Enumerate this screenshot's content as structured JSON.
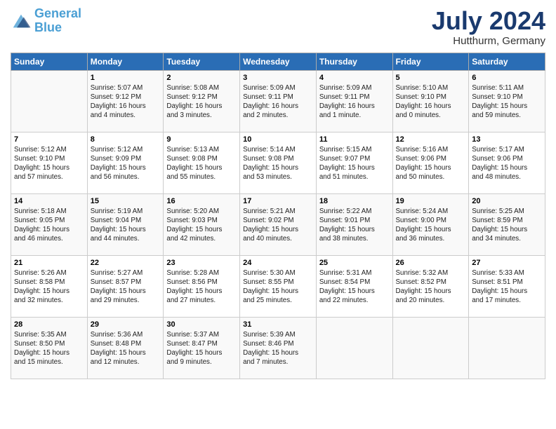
{
  "app": {
    "name": "GeneralBlue",
    "logo_line1": "General",
    "logo_line2": "Blue"
  },
  "calendar": {
    "month_year": "July 2024",
    "location": "Hutthurm, Germany",
    "weekdays": [
      "Sunday",
      "Monday",
      "Tuesday",
      "Wednesday",
      "Thursday",
      "Friday",
      "Saturday"
    ],
    "weeks": [
      [
        {
          "day": "",
          "info": ""
        },
        {
          "day": "1",
          "info": "Sunrise: 5:07 AM\nSunset: 9:12 PM\nDaylight: 16 hours\nand 4 minutes."
        },
        {
          "day": "2",
          "info": "Sunrise: 5:08 AM\nSunset: 9:12 PM\nDaylight: 16 hours\nand 3 minutes."
        },
        {
          "day": "3",
          "info": "Sunrise: 5:09 AM\nSunset: 9:11 PM\nDaylight: 16 hours\nand 2 minutes."
        },
        {
          "day": "4",
          "info": "Sunrise: 5:09 AM\nSunset: 9:11 PM\nDaylight: 16 hours\nand 1 minute."
        },
        {
          "day": "5",
          "info": "Sunrise: 5:10 AM\nSunset: 9:10 PM\nDaylight: 16 hours\nand 0 minutes."
        },
        {
          "day": "6",
          "info": "Sunrise: 5:11 AM\nSunset: 9:10 PM\nDaylight: 15 hours\nand 59 minutes."
        }
      ],
      [
        {
          "day": "7",
          "info": "Sunrise: 5:12 AM\nSunset: 9:10 PM\nDaylight: 15 hours\nand 57 minutes."
        },
        {
          "day": "8",
          "info": "Sunrise: 5:12 AM\nSunset: 9:09 PM\nDaylight: 15 hours\nand 56 minutes."
        },
        {
          "day": "9",
          "info": "Sunrise: 5:13 AM\nSunset: 9:08 PM\nDaylight: 15 hours\nand 55 minutes."
        },
        {
          "day": "10",
          "info": "Sunrise: 5:14 AM\nSunset: 9:08 PM\nDaylight: 15 hours\nand 53 minutes."
        },
        {
          "day": "11",
          "info": "Sunrise: 5:15 AM\nSunset: 9:07 PM\nDaylight: 15 hours\nand 51 minutes."
        },
        {
          "day": "12",
          "info": "Sunrise: 5:16 AM\nSunset: 9:06 PM\nDaylight: 15 hours\nand 50 minutes."
        },
        {
          "day": "13",
          "info": "Sunrise: 5:17 AM\nSunset: 9:06 PM\nDaylight: 15 hours\nand 48 minutes."
        }
      ],
      [
        {
          "day": "14",
          "info": "Sunrise: 5:18 AM\nSunset: 9:05 PM\nDaylight: 15 hours\nand 46 minutes."
        },
        {
          "day": "15",
          "info": "Sunrise: 5:19 AM\nSunset: 9:04 PM\nDaylight: 15 hours\nand 44 minutes."
        },
        {
          "day": "16",
          "info": "Sunrise: 5:20 AM\nSunset: 9:03 PM\nDaylight: 15 hours\nand 42 minutes."
        },
        {
          "day": "17",
          "info": "Sunrise: 5:21 AM\nSunset: 9:02 PM\nDaylight: 15 hours\nand 40 minutes."
        },
        {
          "day": "18",
          "info": "Sunrise: 5:22 AM\nSunset: 9:01 PM\nDaylight: 15 hours\nand 38 minutes."
        },
        {
          "day": "19",
          "info": "Sunrise: 5:24 AM\nSunset: 9:00 PM\nDaylight: 15 hours\nand 36 minutes."
        },
        {
          "day": "20",
          "info": "Sunrise: 5:25 AM\nSunset: 8:59 PM\nDaylight: 15 hours\nand 34 minutes."
        }
      ],
      [
        {
          "day": "21",
          "info": "Sunrise: 5:26 AM\nSunset: 8:58 PM\nDaylight: 15 hours\nand 32 minutes."
        },
        {
          "day": "22",
          "info": "Sunrise: 5:27 AM\nSunset: 8:57 PM\nDaylight: 15 hours\nand 29 minutes."
        },
        {
          "day": "23",
          "info": "Sunrise: 5:28 AM\nSunset: 8:56 PM\nDaylight: 15 hours\nand 27 minutes."
        },
        {
          "day": "24",
          "info": "Sunrise: 5:30 AM\nSunset: 8:55 PM\nDaylight: 15 hours\nand 25 minutes."
        },
        {
          "day": "25",
          "info": "Sunrise: 5:31 AM\nSunset: 8:54 PM\nDaylight: 15 hours\nand 22 minutes."
        },
        {
          "day": "26",
          "info": "Sunrise: 5:32 AM\nSunset: 8:52 PM\nDaylight: 15 hours\nand 20 minutes."
        },
        {
          "day": "27",
          "info": "Sunrise: 5:33 AM\nSunset: 8:51 PM\nDaylight: 15 hours\nand 17 minutes."
        }
      ],
      [
        {
          "day": "28",
          "info": "Sunrise: 5:35 AM\nSunset: 8:50 PM\nDaylight: 15 hours\nand 15 minutes."
        },
        {
          "day": "29",
          "info": "Sunrise: 5:36 AM\nSunset: 8:48 PM\nDaylight: 15 hours\nand 12 minutes."
        },
        {
          "day": "30",
          "info": "Sunrise: 5:37 AM\nSunset: 8:47 PM\nDaylight: 15 hours\nand 9 minutes."
        },
        {
          "day": "31",
          "info": "Sunrise: 5:39 AM\nSunset: 8:46 PM\nDaylight: 15 hours\nand 7 minutes."
        },
        {
          "day": "",
          "info": ""
        },
        {
          "day": "",
          "info": ""
        },
        {
          "day": "",
          "info": ""
        }
      ]
    ]
  }
}
